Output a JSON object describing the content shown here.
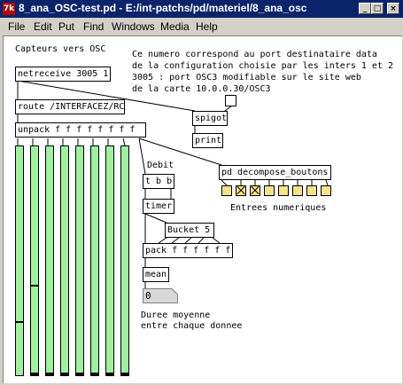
{
  "window": {
    "title": "8_ana_OSC-test.pd - E:/int-patchs/pd/materiel/8_ana_osc",
    "icon_label": "7k",
    "minimize": "_",
    "maximize": "□",
    "close": "×"
  },
  "menu": [
    "File",
    "Edit",
    "Put",
    "Find",
    "Windows",
    "Media",
    "Help"
  ],
  "comments": {
    "header": "Capteurs vers OSC",
    "info_1": "Ce numero correspond au port destinataire data",
    "info_2": "de la configuration choisie par les inters 1 et 2",
    "info_3": "3005 : port OSC3 modifiable sur le site web",
    "info_4": "de la carte 10.0.0.30/OSC3",
    "debit": "Debit",
    "entrees": "Entrees numeriques",
    "duree_1": "Duree moyenne",
    "duree_2": "entre chaque donnee"
  },
  "objects": {
    "netreceive": "netreceive 3005 1",
    "route": "route /INTERFACEZ/RC",
    "spigot": "spigot",
    "print": "print",
    "unpack": "unpack f f f f f f f f",
    "decompose": "pd decompose_boutons",
    "tbb": "t b b",
    "timer": "timer",
    "bucket": "Bucket 5",
    "pack": "pack f f f f f f",
    "mean": "mean"
  },
  "number_box": {
    "value": "0"
  },
  "sliders": [
    0.23,
    1.0,
    1.0,
    1.0,
    1.0,
    1.0,
    1.0,
    1.0
  ],
  "slider_knob_level": [
    0.23,
    0.39
  ],
  "toggles": [
    false,
    true,
    true,
    false,
    false,
    false,
    false,
    false
  ]
}
